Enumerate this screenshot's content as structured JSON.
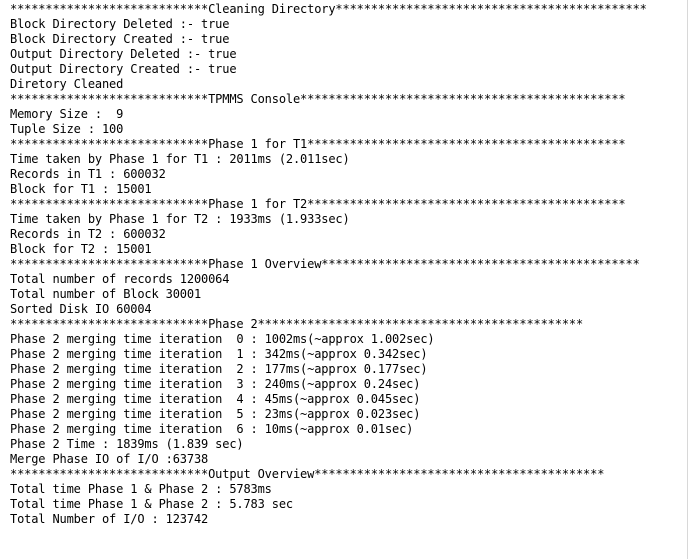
{
  "console": {
    "lines": [
      "****************************Cleaning Directory********************************************",
      "Block Directory Deleted :- true",
      "Block Directory Created :- true",
      "Output Directory Deleted :- true",
      "Output Directory Created :- true",
      "Diretory Cleaned",
      "****************************TPMMS Console**********************************************",
      "Memory Size :  9",
      "Tuple Size : 100",
      "****************************Phase 1 for T1*********************************************",
      "Time taken by Phase 1 for T1 : 2011ms (2.011sec)",
      "Records in T1 : 600032",
      "Block for T1 : 15001",
      "****************************Phase 1 for T2*********************************************",
      "Time taken by Phase 1 for T2 : 1933ms (1.933sec)",
      "Records in T2 : 600032",
      "Block for T2 : 15001",
      "****************************Phase 1 Overview*********************************************",
      "Total number of records 1200064",
      "Total number of Block 30001",
      "Sorted Disk IO 60004",
      "****************************Phase 2**********************************************",
      "Phase 2 merging time iteration  0 : 1002ms(~approx 1.002sec)",
      "Phase 2 merging time iteration  1 : 342ms(~approx 0.342sec)",
      "Phase 2 merging time iteration  2 : 177ms(~approx 0.177sec)",
      "Phase 2 merging time iteration  3 : 240ms(~approx 0.24sec)",
      "Phase 2 merging time iteration  4 : 45ms(~approx 0.045sec)",
      "Phase 2 merging time iteration  5 : 23ms(~approx 0.023sec)",
      "Phase 2 merging time iteration  6 : 10ms(~approx 0.01sec)",
      "Phase 2 Time : 1839ms (1.839 sec)",
      "Merge Phase IO of I/O :63738",
      "****************************Output Overview*****************************************",
      "Total time Phase 1 & Phase 2 : 5783ms",
      "Total time Phase 1 & Phase 2 : 5.783 sec",
      "Total Number of I/O : 123742"
    ]
  }
}
